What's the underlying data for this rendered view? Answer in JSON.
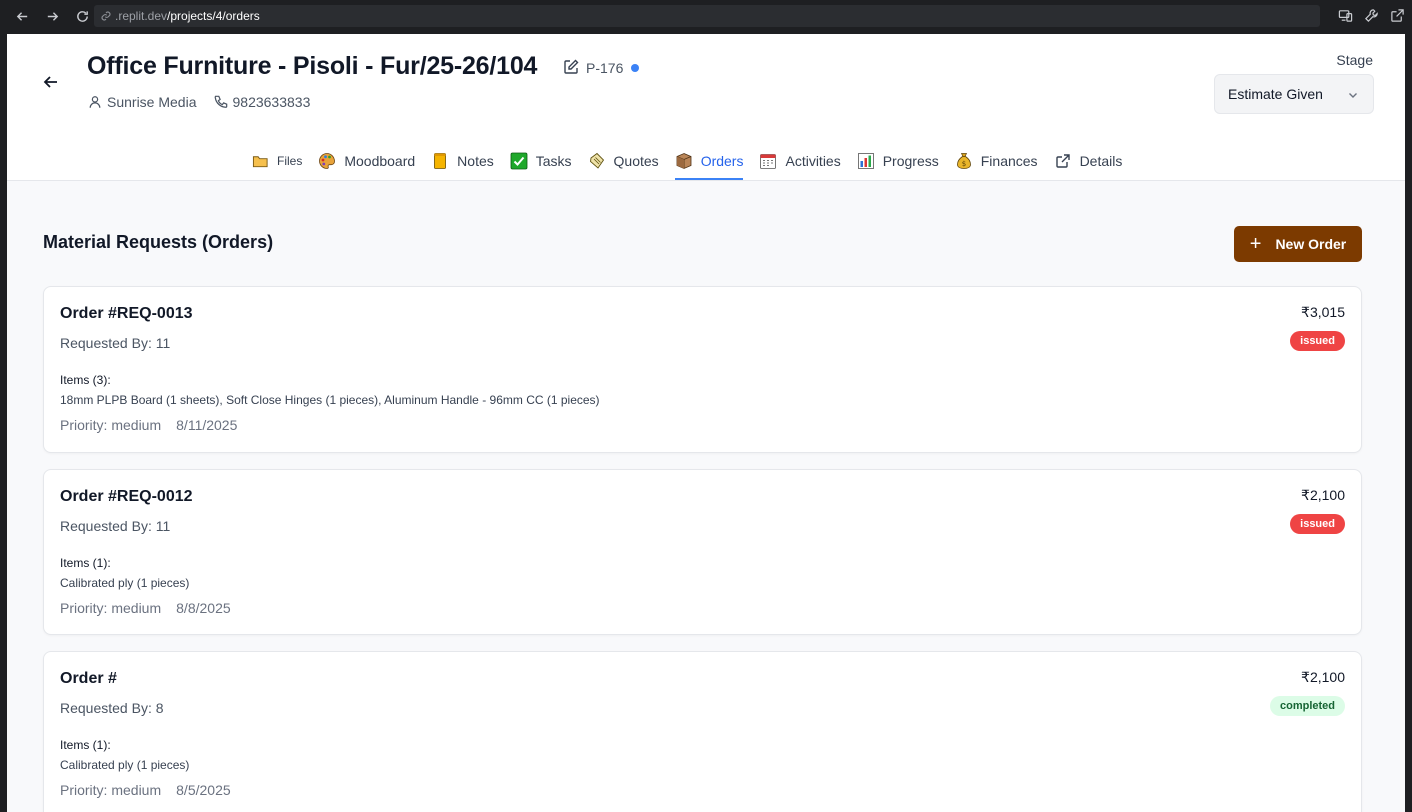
{
  "browser": {
    "url_domain": ".replit.dev",
    "url_path": "/projects/4/orders"
  },
  "project": {
    "title": "Office Furniture - Pisoli - Fur/25-26/104",
    "code": "P-176",
    "client": "Sunrise Media",
    "phone": "9823633833",
    "stage_label": "Stage",
    "stage_value": "Estimate Given"
  },
  "tabs": [
    {
      "label": "Files",
      "icon": "folder-icon"
    },
    {
      "label": "Moodboard",
      "icon": "palette-icon"
    },
    {
      "label": "Notes",
      "icon": "notepad-icon"
    },
    {
      "label": "Tasks",
      "icon": "checkbox-icon"
    },
    {
      "label": "Quotes",
      "icon": "scroll-icon"
    },
    {
      "label": "Orders",
      "icon": "box-icon",
      "active": true
    },
    {
      "label": "Activities",
      "icon": "calendar-icon"
    },
    {
      "label": "Progress",
      "icon": "bar-chart-icon"
    },
    {
      "label": "Finances",
      "icon": "money-bag-icon"
    },
    {
      "label": "Details",
      "icon": "external-link-icon"
    }
  ],
  "main": {
    "section_title": "Material Requests (Orders)",
    "new_order_label": "New Order"
  },
  "orders": [
    {
      "title": "Order #REQ-0013",
      "requested_by": "Requested By: 11",
      "items_label": "Items (3):",
      "items": "18mm PLPB Board (1 sheets), Soft Close Hinges (1 pieces), Aluminum Handle - 96mm CC (1 pieces)",
      "priority": "Priority: medium",
      "date": "8/11/2025",
      "amount": "₹3,015",
      "status": "issued"
    },
    {
      "title": "Order #REQ-0012",
      "requested_by": "Requested By: 11",
      "items_label": "Items (1):",
      "items": "Calibrated ply (1 pieces)",
      "priority": "Priority: medium",
      "date": "8/8/2025",
      "amount": "₹2,100",
      "status": "issued"
    },
    {
      "title": "Order #",
      "requested_by": "Requested By: 8",
      "items_label": "Items (1):",
      "items": "Calibrated ply (1 pieces)",
      "priority": "Priority: medium",
      "date": "8/5/2025",
      "amount": "₹2,100",
      "status": "completed"
    }
  ],
  "colors": {
    "accent": "#2563eb",
    "primary_button": "#7c3a00",
    "issued": "#ef4444",
    "completed_bg": "#dcfce7",
    "completed_text": "#166534"
  }
}
